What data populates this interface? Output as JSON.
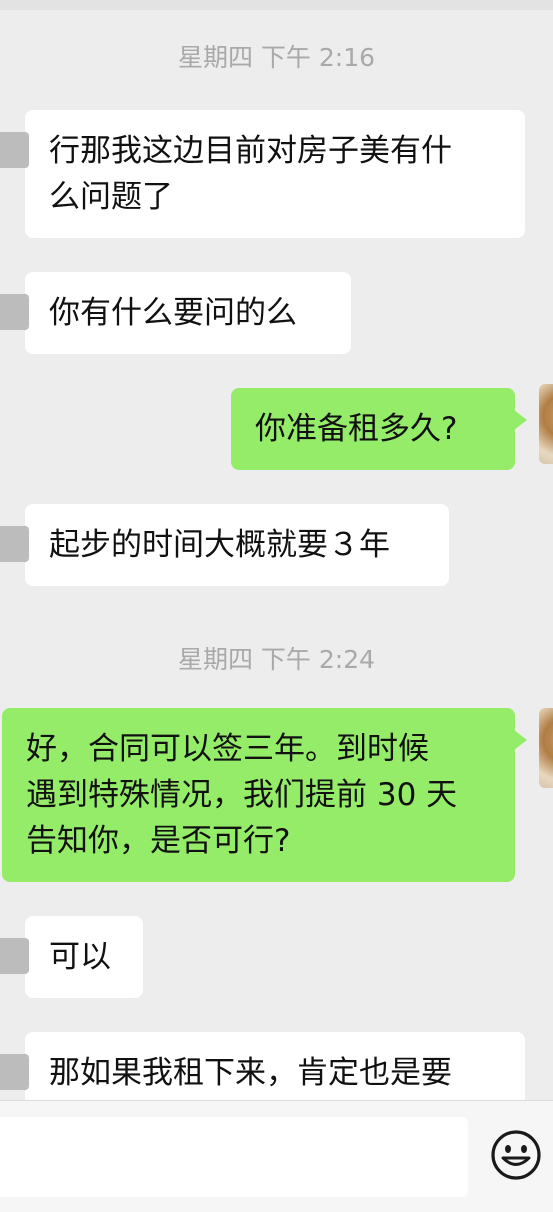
{
  "timestamps": [
    "星期四 下午 2:16",
    "星期四 下午 2:24"
  ],
  "messages": [
    {
      "from": "other",
      "lines": [
        "行那我这边目前对房子美有什",
        "么问题了"
      ]
    },
    {
      "from": "other",
      "lines": [
        "你有什么要问的么"
      ]
    },
    {
      "from": "me",
      "lines": [
        "你准备租多久?"
      ]
    },
    {
      "from": "other",
      "lines": [
        "起步的时间大概就要３年"
      ]
    },
    {
      "from": "me",
      "lines": [
        "好，合同可以签三年。到时候",
        "遇到特殊情况，我们提前 30 天",
        "告知你，是否可行?"
      ]
    },
    {
      "from": "other",
      "lines": [
        "可以"
      ]
    },
    {
      "from": "other",
      "lines": [
        "那如果我租下来，肯定也是要"
      ]
    }
  ],
  "input": {
    "value": "",
    "emoji_icon": "smiley-icon"
  },
  "colors": {
    "background": "#ededed",
    "incoming": "#ffffff",
    "outgoing": "#95ec69",
    "timestamp": "#a9a9a9"
  }
}
